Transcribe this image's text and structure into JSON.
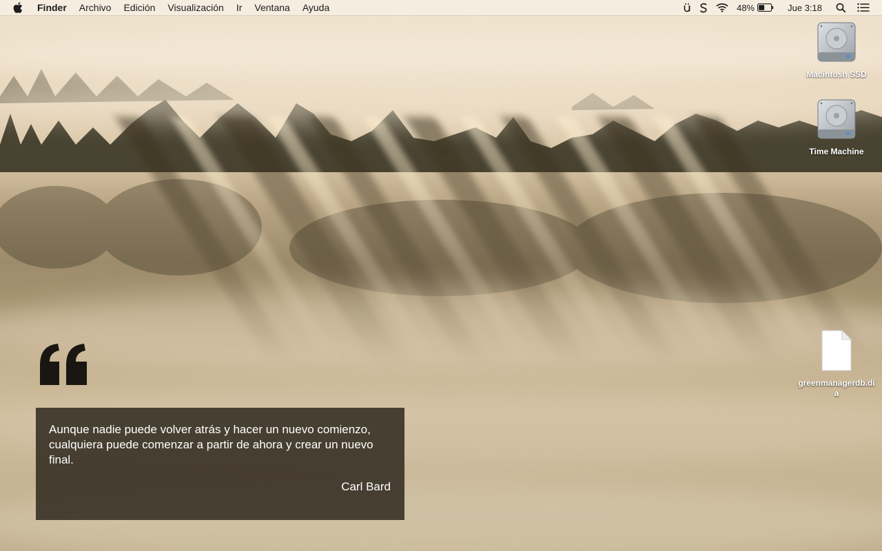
{
  "menubar": {
    "app_name": "Finder",
    "items": [
      "Archivo",
      "Edición",
      "Visualización",
      "Ir",
      "Ventana",
      "Ayuda"
    ],
    "status": {
      "battery_percent": "48%",
      "battery_level": 0.48,
      "clock": "Jue 3:18"
    }
  },
  "desktop": {
    "icons": [
      {
        "label": "Macintosh SSD",
        "icon": "hard-drive-icon"
      },
      {
        "label": "Time Machine",
        "icon": "hard-drive-icon"
      },
      {
        "label": "greenmanagerdb.dia",
        "icon": "document-icon"
      }
    ]
  },
  "quote": {
    "text": "Aunque nadie puede volver atrás y hacer un nuevo comienzo, cualquiera puede comenzar a partir de ahora y crear un nuevo final.",
    "author": "Carl Bard"
  }
}
